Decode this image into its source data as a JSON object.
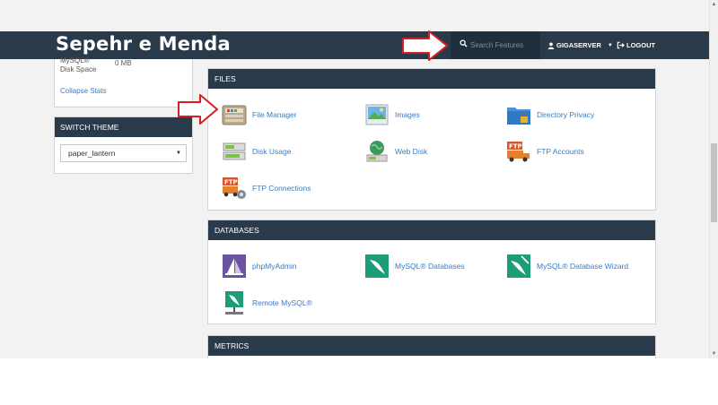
{
  "header": {
    "brand": "Sepehr e Menda",
    "search_placeholder": "Search Features",
    "username": "GIGASERVER",
    "logout_label": "LOGOUT"
  },
  "sidebar": {
    "stats": {
      "label": "MySQL® Disk Space",
      "value": "0 MB",
      "collapse_label": "Collapse Stats"
    },
    "switch_theme": {
      "title": "SWITCH THEME",
      "selected": "paper_lantern"
    }
  },
  "groups": {
    "files": {
      "title": "FILES",
      "items": [
        {
          "label": "File Manager",
          "icon": "file-manager-icon"
        },
        {
          "label": "Images",
          "icon": "images-icon"
        },
        {
          "label": "Directory Privacy",
          "icon": "directory-privacy-icon"
        },
        {
          "label": "Disk Usage",
          "icon": "disk-usage-icon"
        },
        {
          "label": "Web Disk",
          "icon": "web-disk-icon"
        },
        {
          "label": "FTP Accounts",
          "icon": "ftp-accounts-icon"
        },
        {
          "label": "FTP Connections",
          "icon": "ftp-connections-icon"
        }
      ]
    },
    "databases": {
      "title": "DATABASES",
      "items": [
        {
          "label": "phpMyAdmin",
          "icon": "phpmyadmin-icon"
        },
        {
          "label": "MySQL® Databases",
          "icon": "mysql-databases-icon"
        },
        {
          "label": "MySQL® Database Wizard",
          "icon": "mysql-database-wizard-icon"
        },
        {
          "label": "Remote MySQL®",
          "icon": "remote-mysql-icon"
        }
      ]
    },
    "metrics": {
      "title": "METRICS"
    }
  },
  "colors": {
    "header_bg": "#293a4a",
    "link": "#3a7cc0",
    "annotation_arrow": "#d81e24"
  }
}
